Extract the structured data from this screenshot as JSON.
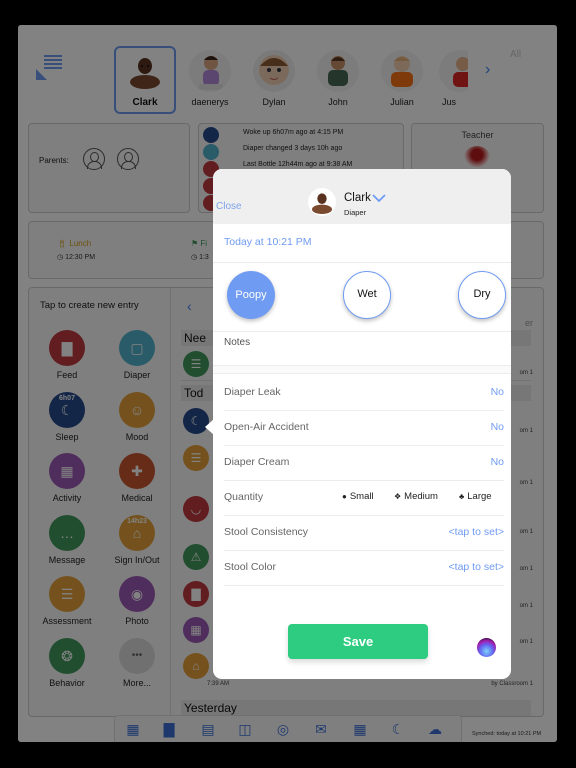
{
  "top_bar": {
    "menu_icon": "sidebar-collapse-icon",
    "children": [
      {
        "name": "Clark",
        "selected": true
      },
      {
        "name": "daenerys",
        "selected": false
      },
      {
        "name": "Dylan",
        "selected": false
      },
      {
        "name": "John",
        "selected": false
      },
      {
        "name": "Julian",
        "selected": false
      },
      {
        "name": "Jus",
        "selected": false
      }
    ],
    "next_icon": "chevron-right-icon",
    "all_label": "All"
  },
  "parents_card": {
    "label": "Parents:",
    "parent_icons": [
      "person-icon",
      "person-icon"
    ]
  },
  "status_card": {
    "lines": [
      "Woke up  6h07m ago at 4:15 PM",
      "Diaper changed  3 days 10h ago",
      "Last Bottle  12h44m ago at 9:38 AM"
    ]
  },
  "teacher_card": {
    "title": "Teacher"
  },
  "schedule": {
    "items": [
      {
        "label": "Lunch",
        "time": "12:30 PM",
        "color": "#d4a017"
      },
      {
        "label": "Fi",
        "time": "1:3",
        "color": "#3f9a5a"
      }
    ]
  },
  "entry_panel": {
    "title": "Tap to create new entry",
    "entries": [
      {
        "label": "Feed",
        "color": "#c0393f",
        "badge": ""
      },
      {
        "label": "Diaper",
        "color": "#52b3cf",
        "badge": ""
      },
      {
        "label": "Sleep",
        "color": "#274b8b",
        "badge": "6h07"
      },
      {
        "label": "Mood",
        "color": "#e5a23a",
        "badge": ""
      },
      {
        "label": "Activity",
        "color": "#9b59b6",
        "badge": ""
      },
      {
        "label": "Medical",
        "color": "#c9572f",
        "badge": ""
      },
      {
        "label": "Message",
        "color": "#3f9a5a",
        "badge": ""
      },
      {
        "label": "Sign In/Out",
        "color": "#e5a23a",
        "badge": "14h23"
      },
      {
        "label": "Assessment",
        "color": "#e5a23a",
        "badge": ""
      },
      {
        "label": "Photo",
        "color": "#9b59b6",
        "badge": ""
      },
      {
        "label": "Behavior",
        "color": "#3f9a5a",
        "badge": ""
      },
      {
        "label": "More...",
        "color": "#dcdcdc",
        "badge": ""
      }
    ]
  },
  "timeline": {
    "back_icon": "chevron-left-icon",
    "sections": [
      "Nee",
      "Tod",
      "Yesterday"
    ],
    "header_right": "er",
    "row_meta": [
      "om 1",
      "om 1",
      "om 1",
      "om 1",
      "om 1",
      "om 1",
      "om 1",
      "by Classroom 1"
    ],
    "last_time": "7:39 AM"
  },
  "toolbar": {
    "icons": [
      "grid-icon",
      "bar-chart-icon",
      "keypad-touch-icon",
      "classroom-icon",
      "settings-icon",
      "mail-icon",
      "calendar-icon",
      "night-moon-icon",
      "cloud-sync-icon"
    ],
    "synched": "Synched: today at 10:21 PM"
  },
  "modal": {
    "close_label": "Close",
    "child_name": "Clark",
    "subtitle": "Diaper",
    "datetime": "Today at 10:21 PM",
    "options": [
      {
        "label": "Poopy",
        "selected": true
      },
      {
        "label": "Wet",
        "selected": false
      },
      {
        "label": "Dry",
        "selected": false
      }
    ],
    "notes_placeholder": "Notes",
    "rows": [
      {
        "label": "Diaper Leak",
        "value": "No"
      },
      {
        "label": "Open-Air Accident",
        "value": "No"
      },
      {
        "label": "Diaper Cream",
        "value": "No"
      }
    ],
    "quantity": {
      "label": "Quantity",
      "options": [
        "Small",
        "Medium",
        "Large"
      ]
    },
    "stool_consistency": {
      "label": "Stool Consistency",
      "value": "<tap to set>"
    },
    "stool_color": {
      "label": "Stool Color",
      "value": "<tap to set>"
    },
    "save_label": "Save",
    "accent_color": "#6f9bf2",
    "save_color": "#2ecc80"
  }
}
